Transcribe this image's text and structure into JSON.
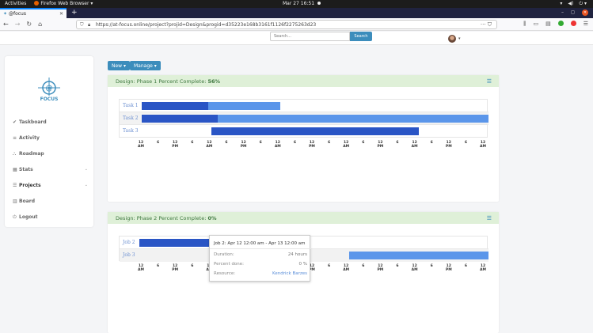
{
  "system_bar": {
    "activities": "Activities",
    "app": "Firefox Web Browser ▾",
    "datetime": "Mar 27  16:51"
  },
  "browser": {
    "tab_title": "@focus",
    "url": "https://at-focus.online/project?projid=Design&progid=d35223e168b3161f1126f2275263d23",
    "url_actions": "··· ⛉"
  },
  "header": {
    "search_placeholder": "Search...",
    "search_button": "Search"
  },
  "sidebar": {
    "logo_text": "FOCUS",
    "items": [
      {
        "label": "Taskboard",
        "icon": "✔"
      },
      {
        "label": "Activity",
        "icon": "≡"
      },
      {
        "label": "Roadmap",
        "icon": "⛬"
      },
      {
        "label": "Stats",
        "icon": "▦",
        "caret": "⌄"
      },
      {
        "label": "Projects",
        "icon": "☰",
        "caret": "⌄"
      },
      {
        "label": "Board",
        "icon": "▥"
      },
      {
        "label": "Logout",
        "icon": "⏻"
      }
    ]
  },
  "actions": {
    "new_label": "New ▾",
    "manage_label": "Manage ▾"
  },
  "panels": [
    {
      "title_prefix": "Design: Phase 1 Percent Complete:",
      "percent": "56%",
      "tasks": [
        {
          "label": "Task 1",
          "progress": 0.48
        },
        {
          "label": "Task 2",
          "progress": 0.22
        },
        {
          "label": "Task 3",
          "progress": 1.0
        }
      ]
    },
    {
      "title_prefix": "Design: Phase 2 Percent Complete:",
      "percent": "0%",
      "tasks": [
        {
          "label": "Job 2"
        },
        {
          "label": "Job 3"
        }
      ]
    }
  ],
  "tick_labels": [
    "12 AM",
    "6",
    "12 PM",
    "6",
    "12 AM",
    "6",
    "12 PM",
    "6",
    "12 AM",
    "6",
    "12 PM",
    "6",
    "12 AM",
    "6",
    "12 PM",
    "6",
    "12 AM",
    "6",
    "12 PM",
    "6",
    "12 AM"
  ],
  "tooltip": {
    "title": "Job 2: Apr 12 12:00 am - Apr 13 12:00 am",
    "duration_label": "Duration:",
    "duration_value": "24 hours",
    "percent_label": "Percent done:",
    "percent_value": "0 %",
    "resource_label": "Resource:",
    "resource_value": "Kendrick Barzes"
  }
}
